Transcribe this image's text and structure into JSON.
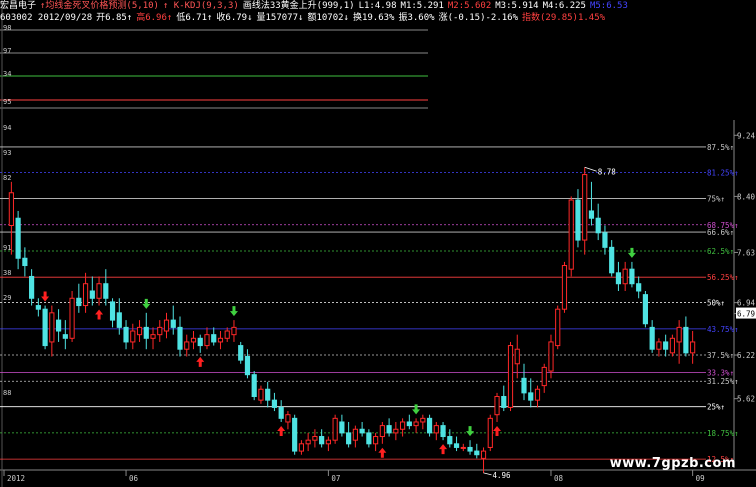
{
  "header": {
    "line1": [
      {
        "text": "宏昌电子",
        "color": "#ffffff"
      },
      {
        "text": "↑均线金死叉价格预测(5,10)",
        "color": "#ff5555"
      },
      {
        "text": "↑ K-KDJ(9,3,3)",
        "color": "#ff5555"
      },
      {
        "text": "画线法33黄金上升(999,1)",
        "color": "#ffffff"
      },
      {
        "text": "L1:4.98",
        "color": "#ffffff"
      },
      {
        "text": "M1:5.291",
        "color": "#ffffff"
      },
      {
        "text": "M2:5.602",
        "color": "#ff4040"
      },
      {
        "text": "M3:5.914",
        "color": "#ffffff"
      },
      {
        "text": "M4:6.225",
        "color": "#ffffff"
      },
      {
        "text": "M5:6.53",
        "color": "#4444ff"
      }
    ],
    "line2": [
      {
        "text": "603002 2012/09/28",
        "color": "#ffffff"
      },
      {
        "text": "开6.85↑",
        "color": "#ffffff"
      },
      {
        "text": "高6.96↑",
        "color": "#ff4040"
      },
      {
        "text": "低6.71↑",
        "color": "#ffffff"
      },
      {
        "text": "收6.79↓",
        "color": "#ffffff"
      },
      {
        "text": "量157077↓",
        "color": "#ffffff"
      },
      {
        "text": "额10702↓",
        "color": "#ffffff"
      },
      {
        "text": "换19.63%",
        "color": "#ffffff"
      },
      {
        "text": "振3.60%",
        "color": "#ffffff"
      },
      {
        "text": "涨(-0.15)-2.16%",
        "color": "#ffffff"
      },
      {
        "text": "指数(29.85)1.45%",
        "color": "#ff4040"
      }
    ]
  },
  "chart_data": {
    "type": "candlestick",
    "ylim": [
      4.75,
      9.45
    ],
    "right_axis_ticks": [
      "9.24",
      "8.40",
      "7.63",
      "6.94",
      "6.79",
      "6.22",
      "5.62"
    ],
    "left_axis_ticks": [
      "98",
      "97",
      "34",
      "95",
      "94",
      "93",
      "82",
      "91",
      "38",
      "29",
      "88"
    ],
    "x_ticks": [
      "2012",
      "06",
      "07",
      "08",
      "09"
    ],
    "last_price": "6.79",
    "annotations": {
      "high": "8.78",
      "low": "4.96"
    },
    "levels": [
      {
        "pct": "87.5%↑",
        "price": 9.08,
        "color": "#c8c8c8"
      },
      {
        "pct": "81.25%↑",
        "price": 8.73,
        "color": "#4444ff"
      },
      {
        "pct": "75%↑",
        "price": 8.37,
        "color": "#c8c8c8"
      },
      {
        "pct": "68.75%↑",
        "price": 8.01,
        "color": "#d050d0"
      },
      {
        "pct": "66.6%↑",
        "price": 7.91,
        "color": "#c8c8c8"
      },
      {
        "pct": "62.5%↑",
        "price": 7.65,
        "color": "#40c040"
      },
      {
        "pct": "56.25%↑",
        "price": 7.29,
        "color": "#ff4040"
      },
      {
        "pct": "50%↑",
        "price": 6.94,
        "color": "#ffffff"
      },
      {
        "pct": "43.75%↑",
        "price": 6.58,
        "color": "#4444ff"
      },
      {
        "pct": "37.5%↑",
        "price": 6.22,
        "color": "#c8c8c8"
      },
      {
        "pct": "33.3%↑",
        "price": 5.98,
        "color": "#d050d0"
      },
      {
        "pct": "31.25%↑",
        "price": 5.86,
        "color": "#c8c8c8"
      },
      {
        "pct": "25%↑",
        "price": 5.51,
        "color": "#ffffff"
      },
      {
        "pct": "18.75%↑",
        "price": 5.15,
        "color": "#40c040"
      },
      {
        "pct": "12.5%↑",
        "price": 4.79,
        "color": "#ff4040"
      }
    ],
    "candles": [
      [
        8.0,
        8.6,
        7.6,
        8.45
      ],
      [
        8.1,
        8.2,
        7.4,
        7.55
      ],
      [
        7.55,
        7.7,
        7.3,
        7.45
      ],
      [
        7.3,
        7.4,
        6.9,
        7.0
      ],
      [
        6.9,
        7.0,
        6.75,
        6.85
      ],
      [
        6.85,
        6.9,
        6.3,
        6.35
      ],
      [
        6.4,
        6.9,
        6.2,
        6.8
      ],
      [
        6.7,
        6.85,
        6.4,
        6.55
      ],
      [
        6.5,
        6.7,
        6.3,
        6.45
      ],
      [
        6.45,
        7.1,
        6.4,
        7.0
      ],
      [
        7.0,
        7.2,
        6.8,
        6.9
      ],
      [
        6.9,
        7.35,
        6.8,
        7.2
      ],
      [
        7.1,
        7.3,
        6.9,
        7.0
      ],
      [
        7.0,
        7.3,
        6.9,
        7.2
      ],
      [
        7.2,
        7.4,
        6.9,
        7.0
      ],
      [
        6.95,
        7.0,
        6.6,
        6.7
      ],
      [
        6.8,
        7.0,
        6.5,
        6.6
      ],
      [
        6.6,
        6.7,
        6.3,
        6.4
      ],
      [
        6.4,
        6.65,
        6.3,
        6.55
      ],
      [
        6.5,
        6.7,
        6.4,
        6.6
      ],
      [
        6.6,
        6.8,
        6.3,
        6.45
      ],
      [
        6.45,
        6.6,
        6.3,
        6.5
      ],
      [
        6.5,
        6.7,
        6.4,
        6.6
      ],
      [
        6.55,
        6.8,
        6.45,
        6.7
      ],
      [
        6.7,
        6.9,
        6.5,
        6.6
      ],
      [
        6.6,
        6.75,
        6.2,
        6.3
      ],
      [
        6.3,
        6.5,
        6.2,
        6.4
      ],
      [
        6.4,
        6.55,
        6.3,
        6.45
      ],
      [
        6.45,
        6.5,
        6.25,
        6.35
      ],
      [
        6.35,
        6.6,
        6.3,
        6.5
      ],
      [
        6.5,
        6.6,
        6.35,
        6.4
      ],
      [
        6.4,
        6.55,
        6.3,
        6.45
      ],
      [
        6.45,
        6.6,
        6.4,
        6.55
      ],
      [
        6.5,
        6.7,
        6.4,
        6.6
      ],
      [
        6.35,
        6.4,
        6.1,
        6.15
      ],
      [
        6.2,
        6.3,
        5.9,
        5.95
      ],
      [
        5.95,
        6.0,
        5.6,
        5.65
      ],
      [
        5.6,
        5.8,
        5.55,
        5.75
      ],
      [
        5.75,
        5.85,
        5.5,
        5.6
      ],
      [
        5.6,
        5.7,
        5.45,
        5.5
      ],
      [
        5.5,
        5.6,
        5.3,
        5.35
      ],
      [
        5.3,
        5.45,
        5.2,
        5.4
      ],
      [
        5.35,
        5.4,
        4.85,
        4.9
      ],
      [
        4.9,
        5.05,
        4.85,
        5.0
      ],
      [
        5.0,
        5.15,
        4.9,
        5.05
      ],
      [
        5.05,
        5.2,
        4.95,
        5.1
      ],
      [
        5.1,
        5.2,
        4.95,
        5.0
      ],
      [
        5.0,
        5.1,
        4.9,
        5.05
      ],
      [
        5.05,
        5.4,
        5.0,
        5.35
      ],
      [
        5.3,
        5.4,
        5.1,
        5.15
      ],
      [
        5.15,
        5.3,
        4.95,
        5.0
      ],
      [
        5.05,
        5.25,
        4.95,
        5.2
      ],
      [
        5.2,
        5.3,
        5.1,
        5.15
      ],
      [
        5.15,
        5.2,
        4.95,
        5.0
      ],
      [
        5.0,
        5.15,
        4.9,
        5.1
      ],
      [
        5.1,
        5.3,
        5.0,
        5.25
      ],
      [
        5.25,
        5.35,
        5.1,
        5.15
      ],
      [
        5.15,
        5.3,
        5.05,
        5.2
      ],
      [
        5.2,
        5.35,
        5.1,
        5.3
      ],
      [
        5.3,
        5.4,
        5.2,
        5.25
      ],
      [
        5.25,
        5.35,
        5.15,
        5.3
      ],
      [
        5.3,
        5.4,
        5.2,
        5.35
      ],
      [
        5.35,
        5.4,
        5.1,
        5.15
      ],
      [
        5.15,
        5.3,
        5.05,
        5.25
      ],
      [
        5.25,
        5.3,
        5.05,
        5.1
      ],
      [
        5.1,
        5.2,
        4.95,
        5.0
      ],
      [
        5.0,
        5.1,
        4.9,
        4.95
      ],
      [
        4.95,
        5.0,
        4.9,
        4.95
      ],
      [
        4.95,
        5.05,
        4.85,
        4.9
      ],
      [
        4.9,
        5.0,
        4.8,
        4.85
      ],
      [
        4.8,
        4.95,
        4.6,
        4.9
      ],
      [
        4.95,
        5.4,
        4.9,
        5.35
      ],
      [
        5.4,
        5.7,
        5.3,
        5.65
      ],
      [
        5.65,
        5.8,
        5.45,
        5.5
      ],
      [
        5.5,
        6.4,
        5.45,
        6.35
      ],
      [
        6.1,
        6.5,
        5.9,
        6.3
      ],
      [
        5.9,
        6.1,
        5.6,
        5.7
      ],
      [
        5.7,
        5.9,
        5.5,
        5.6
      ],
      [
        5.6,
        5.8,
        5.5,
        5.75
      ],
      [
        5.8,
        6.1,
        5.7,
        6.05
      ],
      [
        6.0,
        6.5,
        5.9,
        6.4
      ],
      [
        6.35,
        6.9,
        6.3,
        6.85
      ],
      [
        6.85,
        7.5,
        6.8,
        7.45
      ],
      [
        7.4,
        8.4,
        7.3,
        8.35
      ],
      [
        8.35,
        8.5,
        7.7,
        7.8
      ],
      [
        7.8,
        8.8,
        7.6,
        8.7
      ],
      [
        8.2,
        8.6,
        8.0,
        8.1
      ],
      [
        8.1,
        8.3,
        7.8,
        7.9
      ],
      [
        7.9,
        8.0,
        7.6,
        7.7
      ],
      [
        7.7,
        7.8,
        7.3,
        7.35
      ],
      [
        7.35,
        7.5,
        7.1,
        7.2
      ],
      [
        7.2,
        7.5,
        7.1,
        7.4
      ],
      [
        7.4,
        7.5,
        7.15,
        7.2
      ],
      [
        7.2,
        7.3,
        7.0,
        7.1
      ],
      [
        7.05,
        7.1,
        6.6,
        6.65
      ],
      [
        6.6,
        6.7,
        6.25,
        6.3
      ],
      [
        6.3,
        6.45,
        6.2,
        6.4
      ],
      [
        6.4,
        6.5,
        6.2,
        6.3
      ],
      [
        6.25,
        6.5,
        6.2,
        6.45
      ],
      [
        6.4,
        6.7,
        6.1,
        6.6
      ],
      [
        6.6,
        6.75,
        6.2,
        6.25
      ],
      [
        6.25,
        6.55,
        6.1,
        6.4
      ]
    ],
    "signals": [
      {
        "i": 5,
        "type": "down",
        "color": "#ff2020"
      },
      {
        "i": 13,
        "type": "up",
        "color": "#ff2020"
      },
      {
        "i": 20,
        "type": "down",
        "color": "#40d040"
      },
      {
        "i": 28,
        "type": "up",
        "color": "#ff2020"
      },
      {
        "i": 33,
        "type": "down",
        "color": "#40d040"
      },
      {
        "i": 40,
        "type": "up",
        "color": "#ff2020"
      },
      {
        "i": 55,
        "type": "up",
        "color": "#ff2020"
      },
      {
        "i": 60,
        "type": "down",
        "color": "#40d040"
      },
      {
        "i": 64,
        "type": "up",
        "color": "#ff2020"
      },
      {
        "i": 68,
        "type": "down",
        "color": "#40d040"
      },
      {
        "i": 72,
        "type": "up",
        "color": "#ff2020"
      },
      {
        "i": 92,
        "type": "down",
        "color": "#40d040"
      }
    ]
  },
  "watermark": "www.7gpzb.com"
}
